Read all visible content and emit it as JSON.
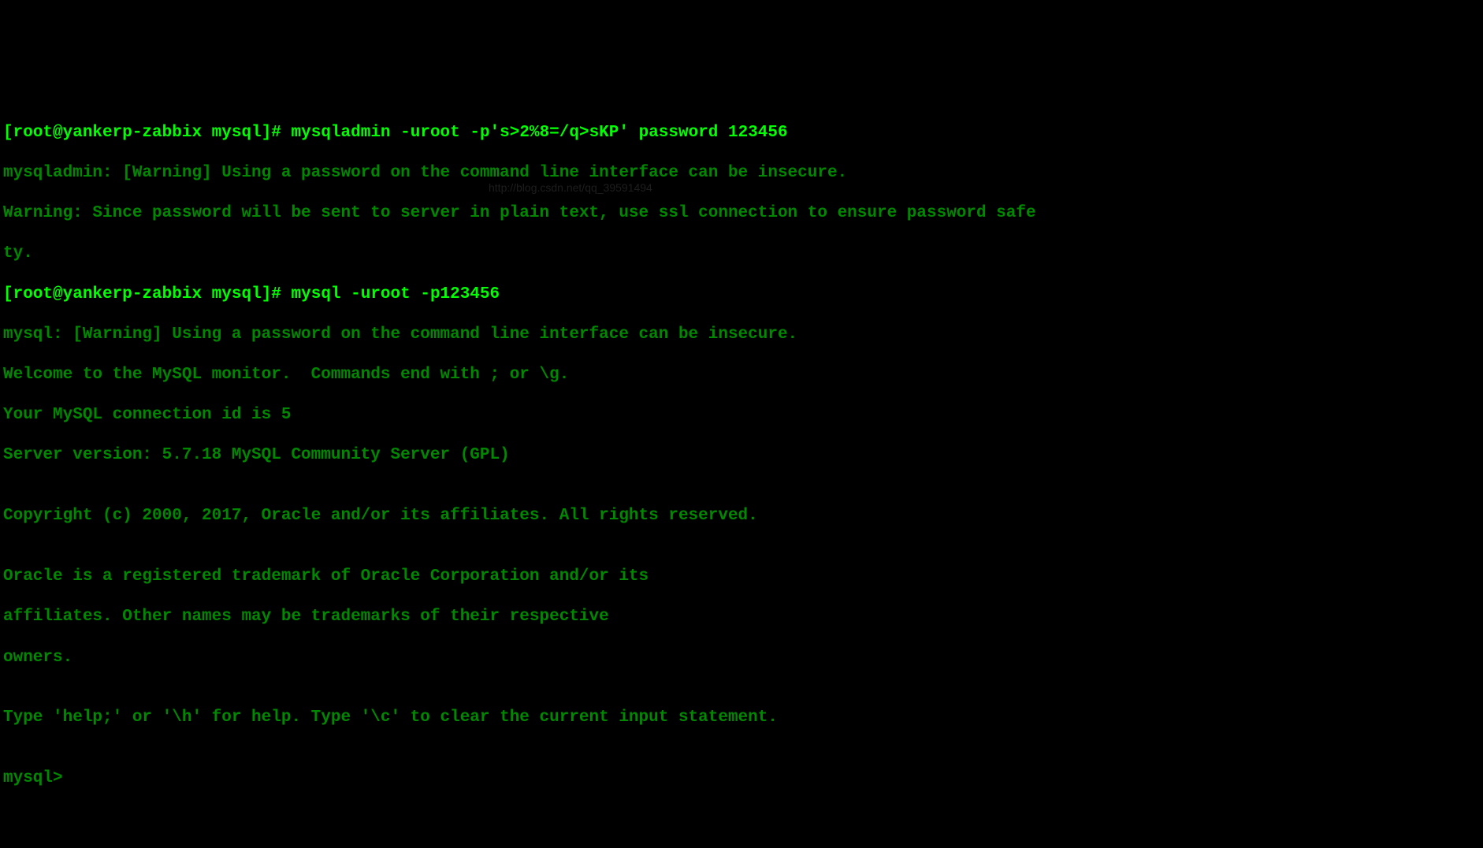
{
  "prompt1": {
    "open": "[",
    "userhost": "root@yankerp-zabbix",
    "dir": " mysql",
    "close": "]",
    "hash": "# ",
    "command": "mysqladmin -uroot -p's>2%8=/q>sKP' password 123456"
  },
  "line2": "mysqladmin: [Warning] Using a password on the command line interface can be insecure.",
  "line3": "Warning: Since password will be sent to server in plain text, use ssl connection to ensure password safe",
  "line4": "ty.",
  "prompt2": {
    "open": "[",
    "userhost": "root@yankerp-zabbix",
    "dir": " mysql",
    "close": "]",
    "hash": "# ",
    "command": "mysql -uroot -p123456"
  },
  "line6": "mysql: [Warning] Using a password on the command line interface can be insecure.",
  "line7": "Welcome to the MySQL monitor.  Commands end with ; or \\g.",
  "line8": "Your MySQL connection id is 5",
  "line9": "Server version: 5.7.18 MySQL Community Server (GPL)",
  "line10": "",
  "line11": "Copyright (c) 2000, 2017, Oracle and/or its affiliates. All rights reserved.",
  "line12": "",
  "line13": "Oracle is a registered trademark of Oracle Corporation and/or its",
  "line14": "affiliates. Other names may be trademarks of their respective",
  "line15": "owners.",
  "line16": "",
  "line17": "Type 'help;' or '\\h' for help. Type '\\c' to clear the current input statement.",
  "line18": "",
  "mysqlprompt": "mysql> ",
  "watermark": "http://blog.csdn.net/qq_39591494"
}
